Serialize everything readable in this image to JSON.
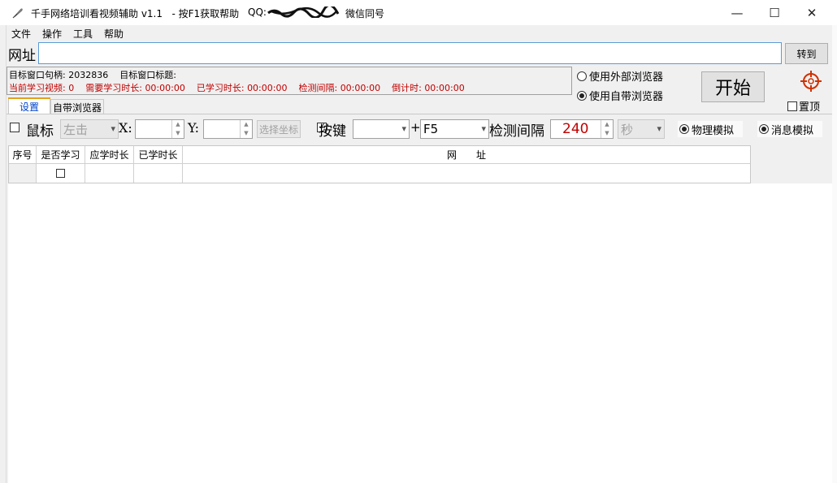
{
  "window": {
    "title": "千手网络培训看视频辅助 v1.1   - 按F1获取帮助",
    "qq_label": "QQ:",
    "wechat_text": "微信同号",
    "controls": {
      "minimize": "—",
      "maximize": "☐",
      "close": "✕"
    }
  },
  "menu": [
    "文件",
    "操作",
    "工具",
    "帮助"
  ],
  "url_bar": {
    "label": "网址",
    "value": "",
    "go_button": "转到"
  },
  "info": {
    "handle_label": "目标窗口句柄:",
    "handle_value": "2032836",
    "title_label": "目标窗口标题:",
    "title_value": "",
    "current_video_label": "当前学习视频:",
    "current_video_value": "0",
    "need_time_label": "需要学习时长:",
    "need_time_value": "00:00:00",
    "learned_time_label": "已学习时长:",
    "learned_time_value": "00:00:00",
    "interval_label": "检测间隔:",
    "interval_value": "00:00:00",
    "countdown_label": "倒计时:",
    "countdown_value": "00:00:00"
  },
  "browser_mode": {
    "external": "使用外部浏览器",
    "builtin": "使用自带浏览器",
    "selected": "builtin"
  },
  "start_button": "开始",
  "pin_top": {
    "label": "置顶",
    "checked": false
  },
  "tabs": [
    "设置",
    "自带浏览器"
  ],
  "controls": {
    "mouse_label": "鼠标",
    "mouse_checked": false,
    "click_type": "左击",
    "x_label": "X:",
    "x_value": "",
    "y_label": "Y:",
    "y_value": "",
    "pick_coord_button": "选择坐标",
    "key_label": "按键",
    "key_checked": true,
    "modifier_value": "",
    "plus": "+",
    "key_value": "F5",
    "interval_label": "检测间隔",
    "interval_value": "240",
    "unit": "秒",
    "physical_sim": "物理模拟",
    "message_sim": "消息模拟",
    "sim_selected": "both"
  },
  "table": {
    "columns": [
      "序号",
      "是否学习",
      "应学时长",
      "已学时长",
      "网　　址"
    ],
    "rows": [
      {
        "index": "",
        "learn": false,
        "need": "",
        "learned": "",
        "url": ""
      }
    ]
  },
  "colors": {
    "accent_red": "#c00000",
    "tab_blue": "#0044cc",
    "url_border": "#5a9bd5"
  }
}
